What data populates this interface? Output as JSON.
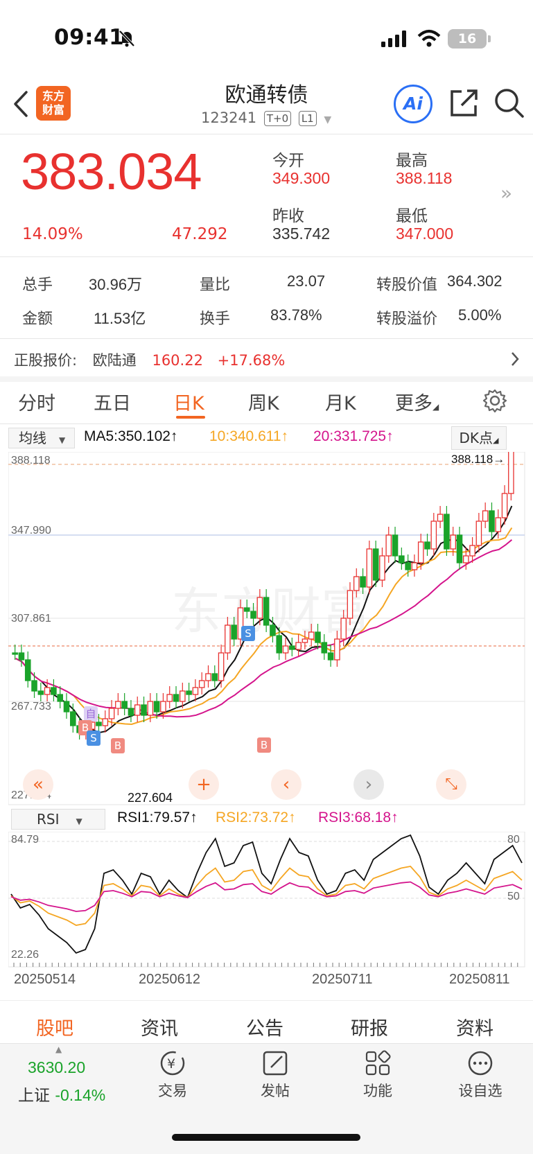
{
  "status_bar": {
    "time": "09:41",
    "battery": "16"
  },
  "header": {
    "title": "欧通转债",
    "code": "123241",
    "tag_t0": "T+0",
    "tag_l1": "L1",
    "logo_line1": "东方",
    "logo_line2": "财富",
    "ai_label": "Ai"
  },
  "quote": {
    "price": "383.034",
    "change_pct": "14.09%",
    "change_amt": "47.292",
    "open_label": "今开",
    "open": "349.300",
    "high_label": "最高",
    "high": "388.118",
    "prev_close_label": "昨收",
    "prev_close": "335.742",
    "low_label": "最低",
    "low": "347.000"
  },
  "stats": {
    "volume_label": "总手",
    "volume": "30.96万",
    "vol_ratio_label": "量比",
    "vol_ratio": "23.07",
    "conv_value_label": "转股价值",
    "conv_value": "364.302",
    "amount_label": "金额",
    "amount": "11.53亿",
    "turnover_label": "换手",
    "turnover": "83.78%",
    "premium_label": "转股溢价",
    "premium": "5.00%"
  },
  "underlying": {
    "label": "正股报价:",
    "name": "欧陆通",
    "price": "160.22",
    "change": "+17.68%"
  },
  "tabs": [
    "分时",
    "五日",
    "日K",
    "周K",
    "月K",
    "更多"
  ],
  "active_tab": "日K",
  "chart": {
    "ma_select": "均线",
    "ma5": "MA5:350.102↑",
    "ma10": "10:340.611↑",
    "ma20": "20:331.725↑",
    "dk_button": "DK点",
    "y_labels": [
      "388.118",
      "347.990",
      "307.861",
      "267.733",
      "227.604"
    ],
    "high_marker": "388.118→",
    "low_marker": "227.604",
    "watermark": "东方财富",
    "colors": {
      "up": "#e8312f",
      "down": "#1aa32a",
      "ma5": "#111111",
      "ma10": "#f5a623",
      "ma20": "#d4148c"
    },
    "signals": [
      "自",
      "B",
      "S",
      "B",
      "S",
      "B"
    ]
  },
  "rsi": {
    "select": "RSI",
    "rsi1": "RSI1:79.57↑",
    "rsi2": "RSI2:73.72↑",
    "rsi3": "RSI3:68.18↑",
    "y_top": "84.79",
    "y_bottom": "22.26",
    "ref80": "80",
    "ref50": "50"
  },
  "dates": [
    "20250514",
    "20250612",
    "20250711",
    "20250811"
  ],
  "bottom_tabs": [
    "股吧",
    "资讯",
    "公告",
    "研报",
    "资料"
  ],
  "bottom_nav": {
    "index_value": "3630.20",
    "index_name": "上证",
    "index_change": "-0.14%",
    "items": [
      "交易",
      "发帖",
      "功能",
      "设自选"
    ]
  }
}
